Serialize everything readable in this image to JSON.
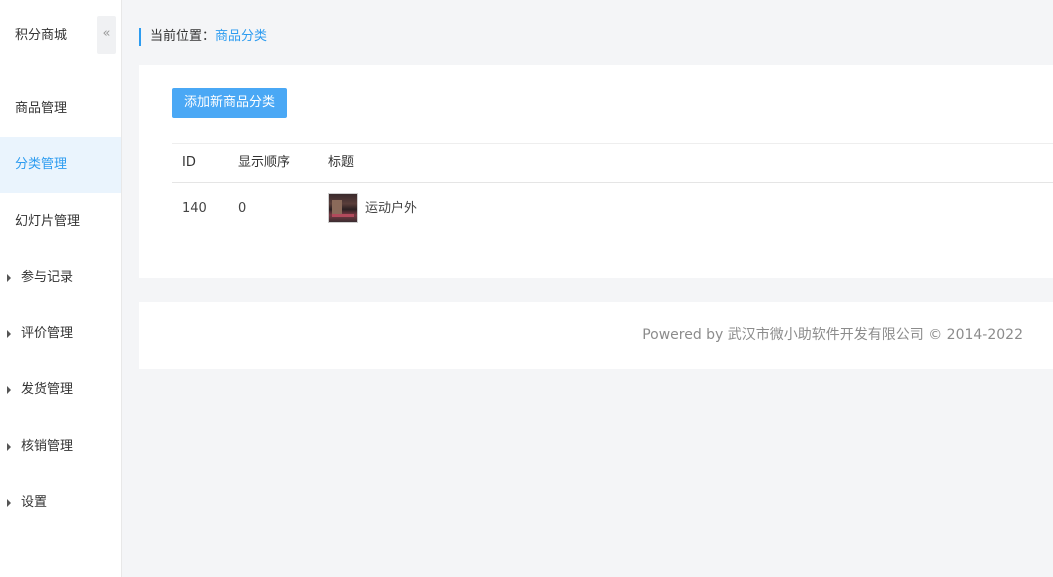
{
  "app": {
    "title": "积分商城",
    "collapse_icon": "«"
  },
  "sidebar": {
    "items": [
      {
        "label": "商品管理",
        "active": false,
        "group": false
      },
      {
        "label": "分类管理",
        "active": true,
        "group": false
      },
      {
        "label": "幻灯片管理",
        "active": false,
        "group": false
      },
      {
        "label": "参与记录",
        "active": false,
        "group": true
      },
      {
        "label": "评价管理",
        "active": false,
        "group": true
      },
      {
        "label": "发货管理",
        "active": false,
        "group": true
      },
      {
        "label": "核销管理",
        "active": false,
        "group": true
      },
      {
        "label": "设置",
        "active": false,
        "group": true
      }
    ]
  },
  "breadcrumb": {
    "prefix": "当前位置：",
    "current": "商品分类"
  },
  "toolbar": {
    "add_label": "添加新商品分类"
  },
  "table": {
    "headers": [
      "ID",
      "显示顺序",
      "标题"
    ],
    "rows": [
      {
        "id": "140",
        "order": "0",
        "title": "运动户外",
        "thumbnail": "category-image"
      }
    ]
  },
  "footer": {
    "text": "Powered by 武汉市微小助软件开发有限公司 © 2014-2022"
  },
  "colors": {
    "accent": "#2d9cf0",
    "button": "#4aa8f5",
    "active_bg": "#eaf4fd",
    "page_bg": "#f4f5f7"
  }
}
